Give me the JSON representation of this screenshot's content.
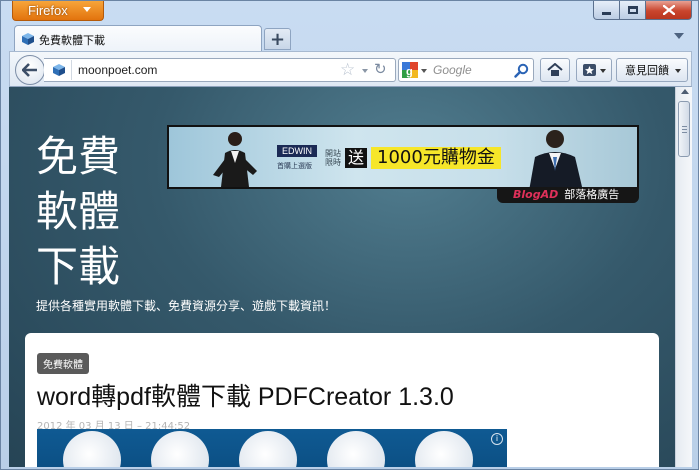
{
  "app": {
    "menu_button": "Firefox"
  },
  "tab": {
    "title": "免費軟體下載"
  },
  "navbar": {
    "url": "moonpoet.com",
    "search_placeholder": "Google",
    "feedback_label": "意見回饋"
  },
  "page": {
    "site_title_lines": [
      "免費",
      "軟體",
      "下載"
    ],
    "tagline": "提供各種實用軟體下載、免費資源分享、遊戲下載資訊！",
    "banner": {
      "brand": "EDWIN",
      "brand_sub": "首購上選版",
      "promo_small_1": "開站",
      "promo_small_2": "限時",
      "promo_box": "送",
      "promo_big": "1000元購物金",
      "ad_network": "BlogAD",
      "ad_label": "部落格廣告"
    },
    "post": {
      "category": "免費軟體",
      "title": "word轉pdf軟體下載 PDFCreator 1.3.0",
      "date": "2012 年 03 月 13 日 – 21:44:52"
    }
  }
}
